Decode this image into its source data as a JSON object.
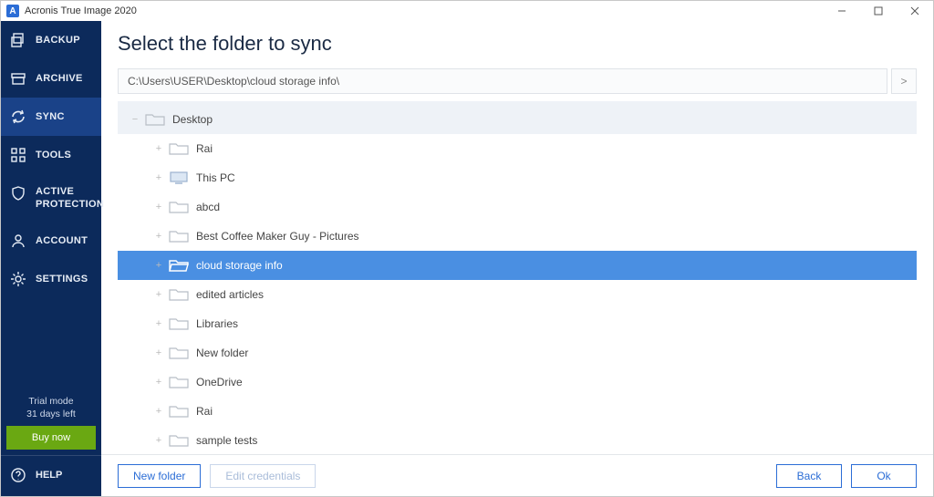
{
  "titlebar": {
    "app_name": "Acronis True Image 2020"
  },
  "sidebar": {
    "items": [
      {
        "label": "BACKUP"
      },
      {
        "label": "ARCHIVE"
      },
      {
        "label": "SYNC"
      },
      {
        "label": "TOOLS"
      },
      {
        "label_line1": "ACTIVE",
        "label_line2": "PROTECTION"
      },
      {
        "label": "ACCOUNT"
      },
      {
        "label": "SETTINGS"
      }
    ],
    "trial_line1": "Trial mode",
    "trial_line2": "31 days left",
    "buy_now": "Buy now",
    "help": "HELP"
  },
  "page": {
    "title": "Select the folder to sync",
    "path": "C:\\Users\\USER\\Desktop\\cloud storage info\\",
    "go_label": ">"
  },
  "tree": {
    "root": "Desktop",
    "children": [
      {
        "label": "Rai",
        "type": "folder"
      },
      {
        "label": "This PC",
        "type": "pc"
      },
      {
        "label": "abcd",
        "type": "folder"
      },
      {
        "label": "Best Coffee Maker Guy - Pictures",
        "type": "folder"
      },
      {
        "label": "cloud storage info",
        "type": "folder",
        "selected": true
      },
      {
        "label": "edited articles",
        "type": "folder"
      },
      {
        "label": "Libraries",
        "type": "folder"
      },
      {
        "label": "New folder",
        "type": "folder"
      },
      {
        "label": "OneDrive",
        "type": "folder"
      },
      {
        "label": "Rai",
        "type": "folder"
      },
      {
        "label": "sample tests",
        "type": "folder"
      }
    ]
  },
  "buttons": {
    "new_folder": "New folder",
    "edit_credentials": "Edit credentials",
    "back": "Back",
    "ok": "Ok"
  }
}
